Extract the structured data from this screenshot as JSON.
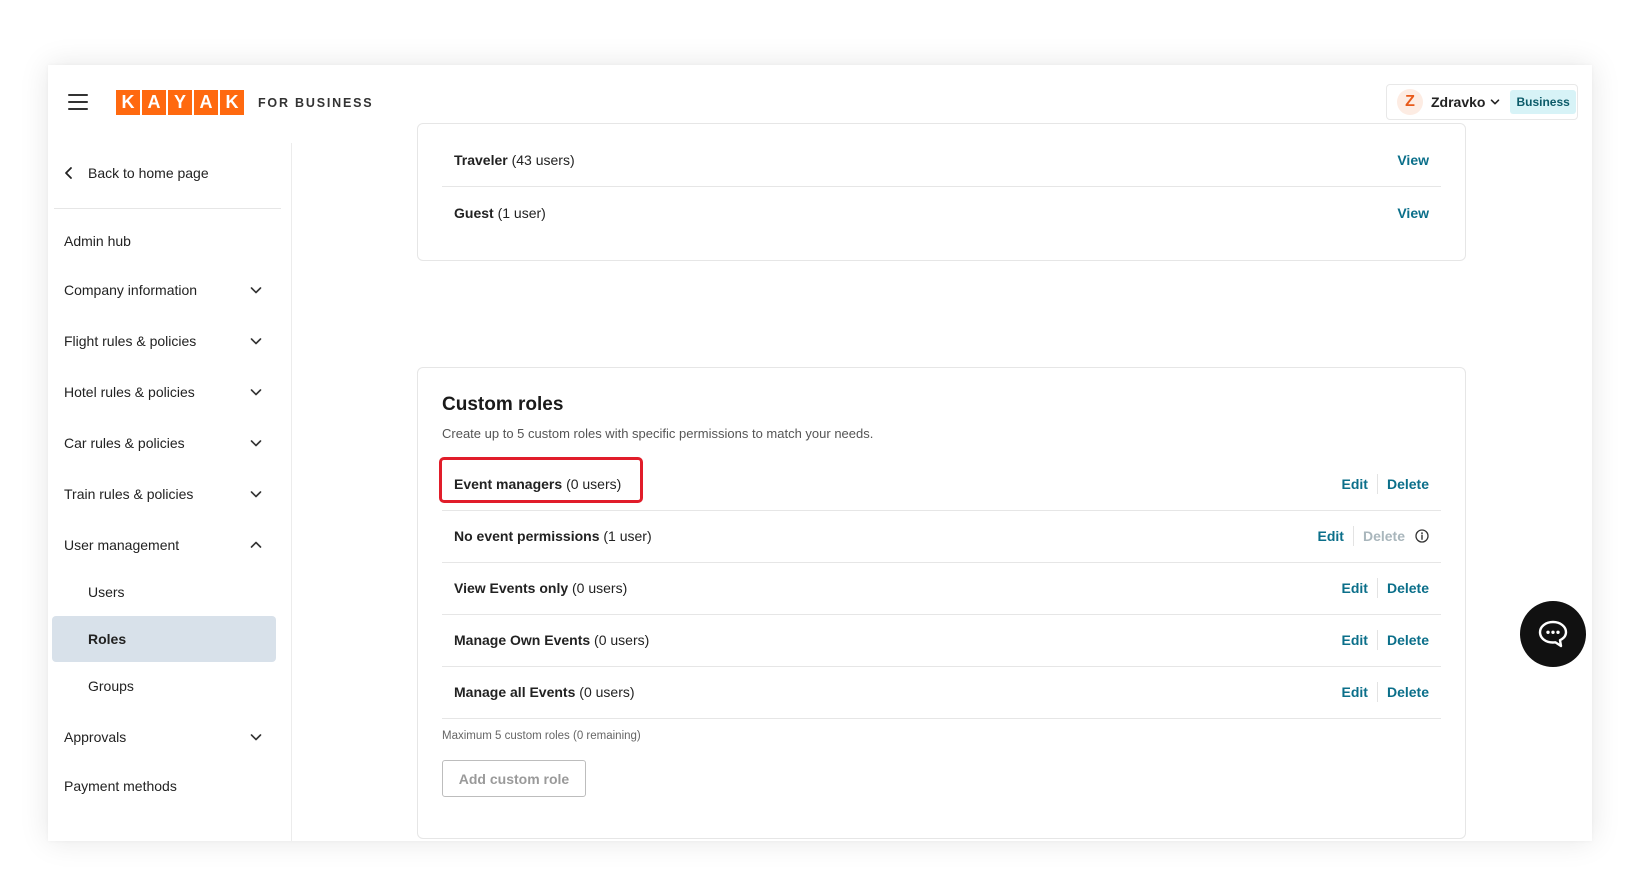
{
  "header": {
    "menu_icon": "hamburger-menu-icon",
    "logo_letters": [
      "K",
      "A",
      "Y",
      "A",
      "K"
    ],
    "logo_suffix": "FOR BUSINESS",
    "brand_color": "#ff690f",
    "user": {
      "initial": "Z",
      "name": "Zdravko",
      "badge": "Business"
    }
  },
  "sidebar": {
    "back_label": "Back to home page",
    "items": [
      {
        "label": "Admin hub",
        "chevron": "none"
      },
      {
        "label": "Company information",
        "chevron": "down"
      },
      {
        "label": "Flight rules & policies",
        "chevron": "down"
      },
      {
        "label": "Hotel rules & policies",
        "chevron": "down"
      },
      {
        "label": "Car rules & policies",
        "chevron": "down"
      },
      {
        "label": "Train rules & policies",
        "chevron": "down"
      },
      {
        "label": "User management",
        "chevron": "up"
      },
      {
        "label": "Users",
        "chevron": "none"
      },
      {
        "label": "Roles",
        "chevron": "none",
        "active": true
      },
      {
        "label": "Groups",
        "chevron": "none"
      },
      {
        "label": "Approvals",
        "chevron": "down"
      },
      {
        "label": "Payment methods",
        "chevron": "none"
      }
    ]
  },
  "default_roles": [
    {
      "name": "Traveler",
      "count": "(43 users)",
      "action": "View"
    },
    {
      "name": "Guest",
      "count": "(1 user)",
      "action": "View"
    }
  ],
  "custom_roles": {
    "title": "Custom roles",
    "description": "Create up to 5 custom roles with specific permissions to match your needs.",
    "rows": [
      {
        "name": "Event managers",
        "count": "(0 users)",
        "edit": "Edit",
        "delete": "Delete",
        "delete_disabled": false
      },
      {
        "name": "No event permissions",
        "count": "(1 user)",
        "edit": "Edit",
        "delete": "Delete",
        "delete_disabled": true
      },
      {
        "name": "View Events only",
        "count": "(0 users)",
        "edit": "Edit",
        "delete": "Delete",
        "delete_disabled": false
      },
      {
        "name": "Manage Own Events",
        "count": "(0 users)",
        "edit": "Edit",
        "delete": "Delete",
        "delete_disabled": false
      },
      {
        "name": "Manage all Events",
        "count": "(0 users)",
        "edit": "Edit",
        "delete": "Delete",
        "delete_disabled": false
      }
    ],
    "max_note": "Maximum 5 custom roles (0 remaining)",
    "add_button": "Add custom role"
  },
  "chat": {
    "icon": "chat-bubble-icon"
  },
  "colors": {
    "link": "#0b6f8a",
    "active_bg": "#d8e1ea",
    "highlight": "#e11d2a",
    "badge_bg": "#d7f3f7"
  }
}
